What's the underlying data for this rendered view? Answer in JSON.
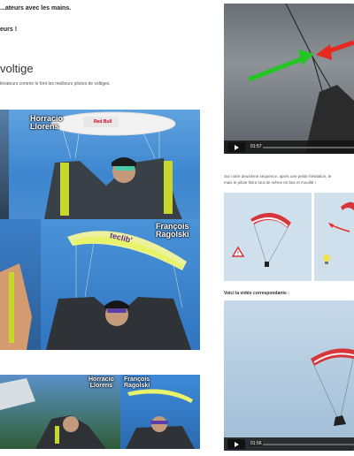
{
  "left": {
    "line1": "...ateurs avec les mains.",
    "line2": "eurs !",
    "heading": "voltige",
    "paragraph": "lévateurs comme le font les meilleurs pilotes de voltiges."
  },
  "collage1": {
    "name1": "Horracio\nLlorens",
    "name2": "François\nRagolski",
    "logo": "teclib'",
    "bull_text": "Red Bull"
  },
  "collage2": {
    "name1": "Horracio\nLlorens",
    "name2": "François\nRagolski"
  },
  "right": {
    "video1_time": "01:57",
    "caption": "Sur notre deuxième séquence, après une petite hésitation, le\nmais le pilote finira tout de même en bas et mouillé !",
    "video_label": "Voici la vidéo correspondante :",
    "video2_time": "01:56"
  },
  "colors": {
    "green_arrow": "#22c522",
    "red_arrow": "#e8281e",
    "sky": "#4a9ee0"
  }
}
